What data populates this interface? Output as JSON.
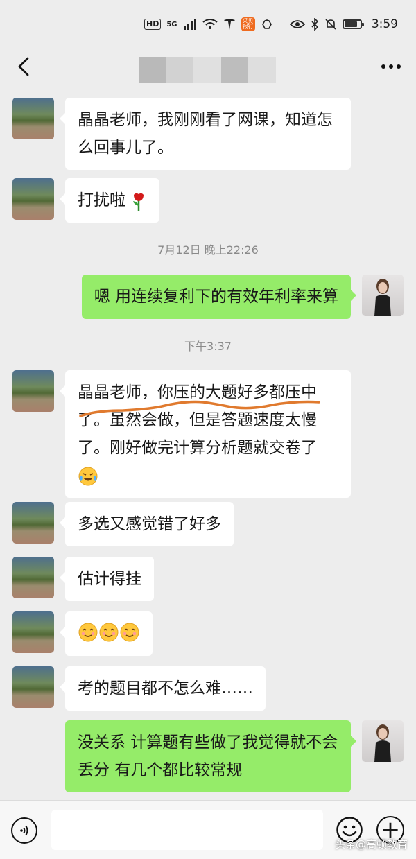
{
  "statusbar": {
    "hd": "HD",
    "network": "5G",
    "app_badge": "采贝 银行",
    "time": "3:59"
  },
  "navbar": {
    "back_icon": "chevron-left-icon",
    "more_icon": "more-dots-icon",
    "title_mosaic_colors": [
      "#b9b9b9",
      "#d2d2d2",
      "#e0e0e0",
      "#bdbdbd",
      "#dedede"
    ]
  },
  "timestamps": [
    "7月12日 晚上22:26",
    "下午3:37"
  ],
  "messages": [
    {
      "from": "friend",
      "text": "晶晶老师，我刚刚看了网课，知道怎么回事儿了。"
    },
    {
      "from": "friend",
      "text": "打扰啦",
      "emoji": "rose"
    },
    {
      "from": "me",
      "text": "嗯 用连续复利下的有效年利率来算"
    },
    {
      "from": "friend",
      "text": "晶晶老师，你压的大题好多都压中了。虽然会做，但是答题速度太慢了。刚好做完计算分析题就交卷了",
      "emoji": "laugh-cry",
      "annotation": "orange-underline"
    },
    {
      "from": "friend",
      "text": "多选又感觉错了好多"
    },
    {
      "from": "friend",
      "text": "估计得挂"
    },
    {
      "from": "friend",
      "text": "",
      "emoji": "smile-x3"
    },
    {
      "from": "friend",
      "text": "考的题目都不怎么难……"
    },
    {
      "from": "me",
      "text": "没关系 计算题有些做了我觉得就不会丢分 有几个都比较常规"
    }
  ],
  "inputbar": {
    "voice_icon": "voice-icon",
    "emoji_icon": "emoji-icon",
    "plus_icon": "plus-icon",
    "plus_label": "+"
  },
  "watermark": "头条@高顿教育",
  "colors": {
    "background": "#ededed",
    "my_bubble": "#95ec69",
    "friend_bubble": "#ffffff",
    "annotation": "#e07a2e"
  }
}
